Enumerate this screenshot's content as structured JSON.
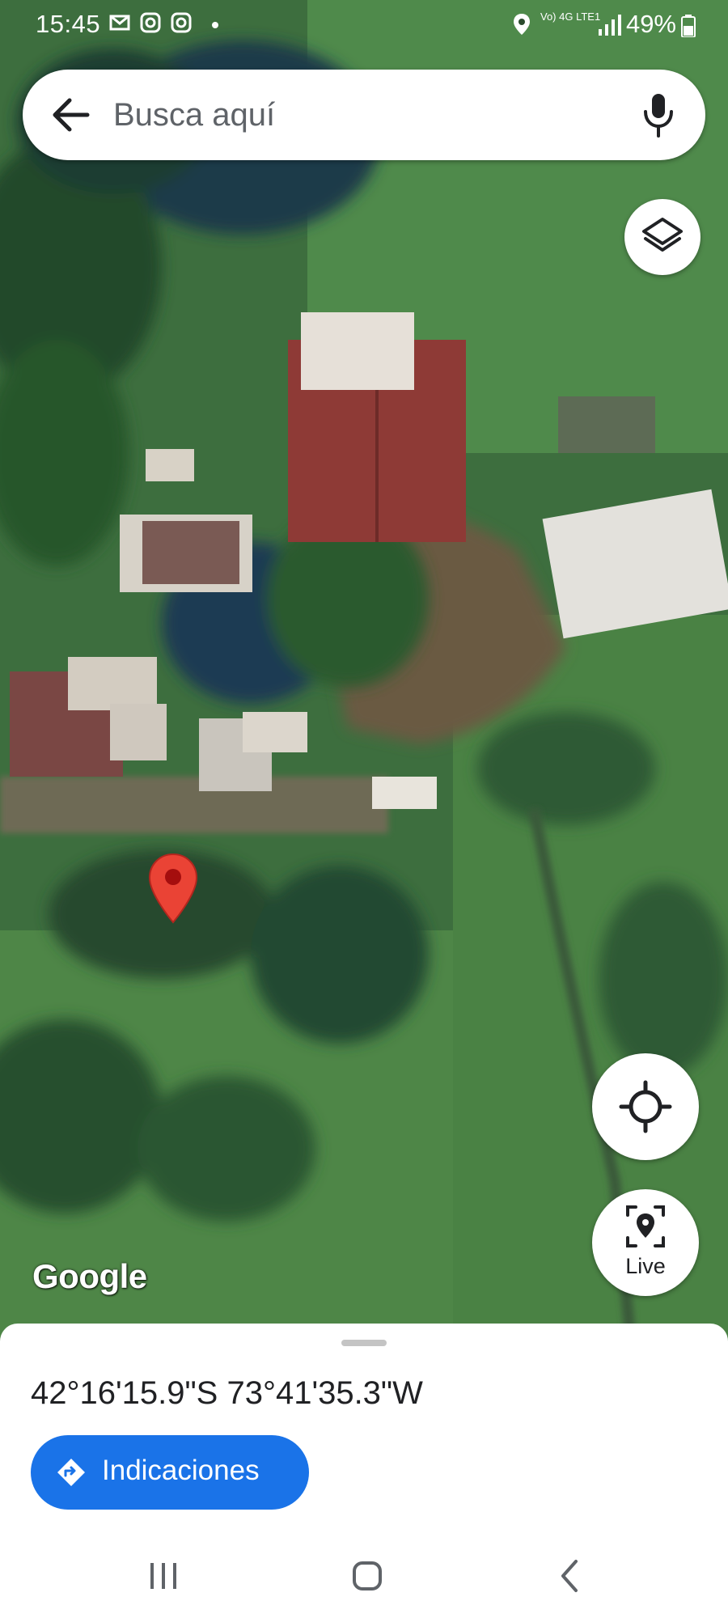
{
  "status_bar": {
    "time": "15:45",
    "network": "Vo) 4G LTE1",
    "battery": "49%"
  },
  "search": {
    "placeholder": "Busca aquí"
  },
  "map": {
    "logo": "Google",
    "type": "satellite"
  },
  "live_button": {
    "label": "Live"
  },
  "bottom_sheet": {
    "coordinates": "42°16'15.9\"S 73°41'35.3\"W",
    "directions_label": "Indicaciones"
  },
  "colors": {
    "accent": "#1a73e8",
    "pin": "#ea4335",
    "roof_red": "#8e3a36"
  },
  "icons": [
    "back-arrow-icon",
    "microphone-icon",
    "layers-icon",
    "my-location-icon",
    "live-view-icon",
    "location-pin-icon",
    "directions-icon",
    "recent-apps-icon",
    "home-icon",
    "back-icon",
    "gmail-icon",
    "instagram-icon",
    "location-status-icon",
    "signal-icon",
    "battery-icon"
  ]
}
